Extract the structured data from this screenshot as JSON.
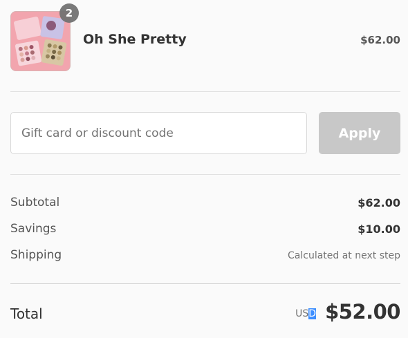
{
  "line_item": {
    "quantity_badge": "2",
    "name": "Oh She Pretty",
    "price": "$62.00"
  },
  "discount": {
    "placeholder": "Gift card or discount code",
    "value": "",
    "apply_label": "Apply"
  },
  "summary": {
    "subtotal_label": "Subtotal",
    "subtotal_value": "$62.00",
    "savings_label": "Savings",
    "savings_value": "$10.00",
    "shipping_label": "Shipping",
    "shipping_value": "Calculated at next step"
  },
  "total": {
    "label": "Total",
    "currency_prefix": "US",
    "currency_selected": "D",
    "amount": "$52.00"
  },
  "colors": {
    "page_background": "#fafafa",
    "apply_disabled": "#c8c8c8",
    "selection_highlight": "#3d8eff",
    "thumbnail_pink": "#f2a5ae"
  }
}
